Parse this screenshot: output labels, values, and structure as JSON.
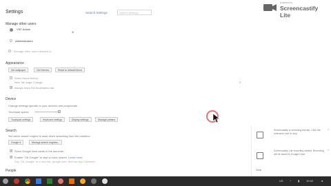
{
  "page": {
    "title": "Settings",
    "search_link": "Search Settings",
    "search_placeholder": "Search settings"
  },
  "watermark": {
    "powered": "powered by",
    "brand": "Screencastify Lite"
  },
  "sections": {
    "people": {
      "heading": "Manage other users",
      "user_name": "VSF Admin",
      "user_sub": "Administrators",
      "row_option": "Manage other users allowed to"
    },
    "appearance": {
      "heading": "Appearance",
      "buttons": [
        "Set wallpaper",
        "Get themes",
        "Reset to default theme"
      ],
      "option1": "Show Home button",
      "option1_sub": "New Tab page  Change",
      "option2": "Always show the bookmarks bar"
    },
    "device": {
      "heading": "Device",
      "desc": "Change settings specific to your devices and peripherals.",
      "label": "Touchpad speed:",
      "buttons": [
        "Touchpad settings",
        "Keyboard settings",
        "Display settings",
        "Manage printers"
      ]
    },
    "search": {
      "heading": "Search",
      "desc": "Set which search engine is used when searching from the omnibox.",
      "engine": "Google",
      "engine_btn": "Manage search engines...",
      "option1": "Show Google Now cards in the launcher",
      "option2": "Enable \"Ok Google\" to start a voice search.",
      "option2_link": "Learn more",
      "option2_sub": "Say \"Ok Google\" in a new tab, google.com, and the App Launcher"
    },
    "people_bottom": {
      "heading": "People"
    }
  },
  "notifications": [
    {
      "text": "Screencastify is recording this tab. Click the extension icon to stop.",
      "close": "×"
    },
    {
      "text": "Screencastify Lite recording started. Recording will be saved to Google Drive.",
      "close": "×"
    }
  ],
  "notif_footer": "Clear",
  "taskbar": {
    "time": "10:42",
    "tray": "US"
  }
}
